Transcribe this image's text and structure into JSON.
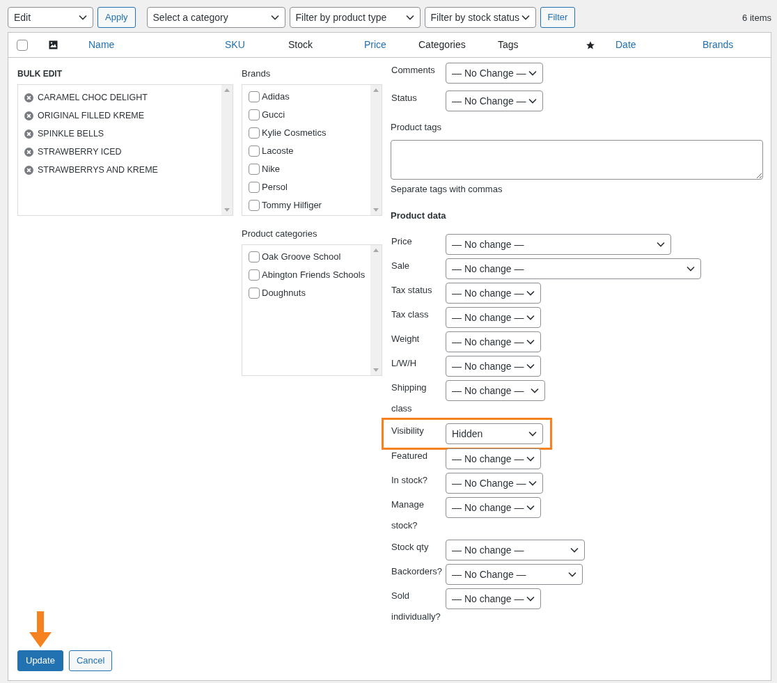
{
  "toolbar": {
    "bulk_action": "Edit",
    "apply": "Apply",
    "filters": [
      "Select a category",
      "Filter by product type",
      "Filter by stock status"
    ],
    "filter_button": "Filter",
    "count": "6 items"
  },
  "table": {
    "columns": [
      {
        "kind": "checkbox",
        "checked": false
      },
      {
        "kind": "image"
      },
      {
        "kind": "text",
        "label": "Name",
        "sortable": true
      },
      {
        "kind": "text",
        "label": "SKU",
        "sortable": true
      },
      {
        "kind": "text",
        "label": "Stock",
        "sortable": false
      },
      {
        "kind": "text",
        "label": "Price",
        "sortable": true
      },
      {
        "kind": "text",
        "label": "Categories",
        "sortable": false
      },
      {
        "kind": "text",
        "label": "Tags",
        "sortable": false
      },
      {
        "kind": "star"
      },
      {
        "kind": "text",
        "label": "Date",
        "sortable": true
      },
      {
        "kind": "text",
        "label": "Brands",
        "sortable": true
      }
    ]
  },
  "bulk_edit": {
    "title": "BULK EDIT",
    "products": [
      "CARAMEL CHOC DELIGHT",
      "ORIGINAL FILLED KREME",
      "SPINKLE BELLS",
      "STRAWBERRY ICED",
      "STRAWBERRYS AND KREME"
    ],
    "brands": {
      "label": "Brands",
      "items": [
        {
          "label": "Adidas",
          "checked": false
        },
        {
          "label": "Gucci",
          "checked": false
        },
        {
          "label": "Kylie Cosmetics",
          "checked": false
        },
        {
          "label": "Lacoste",
          "checked": false
        },
        {
          "label": "Nike",
          "checked": false
        },
        {
          "label": "Persol",
          "checked": false
        },
        {
          "label": "Tommy Hilfiger",
          "checked": false
        }
      ]
    },
    "categories": {
      "label": "Product categories",
      "items": [
        {
          "label": "Oak Groove School",
          "checked": false
        },
        {
          "label": "Abington Friends Schools",
          "checked": false
        },
        {
          "label": "Doughnuts",
          "checked": false
        }
      ]
    },
    "top_fields": [
      {
        "label": "Comments",
        "value": "— No Change —",
        "highlighted": false
      },
      {
        "label": "Status",
        "value": "— No Change —",
        "highlighted": false
      }
    ],
    "product_tags": {
      "label": "Product tags",
      "hint": "Separate tags with commas"
    },
    "product_data": {
      "heading": "Product data",
      "fields": [
        {
          "label": "Price",
          "value": "— No change —",
          "highlighted": false
        },
        {
          "label": "Sale",
          "value": "— No change —",
          "highlighted": false
        },
        {
          "label": "Tax status",
          "value": "— No change —",
          "highlighted": false
        },
        {
          "label": "Tax class",
          "value": "— No change —",
          "highlighted": false
        },
        {
          "label": "Weight",
          "value": "— No change —",
          "highlighted": false
        },
        {
          "label": "L/W/H",
          "value": "— No change —",
          "highlighted": false
        },
        {
          "label": "Shipping class",
          "value": "— No change —",
          "highlighted": false
        },
        {
          "label": "Visibility",
          "value": "Hidden",
          "highlighted": true
        },
        {
          "label": "Featured",
          "value": "— No change —",
          "highlighted": false
        },
        {
          "label": "In stock?",
          "value": "— No Change —",
          "highlighted": false
        },
        {
          "label": "Manage stock?",
          "value": "— No change —",
          "highlighted": false
        },
        {
          "label": "Stock qty",
          "value": "— No change —",
          "highlighted": false
        },
        {
          "label": "Backorders?",
          "value": "— No Change —",
          "highlighted": false
        },
        {
          "label": "Sold individually?",
          "value": "— No change —",
          "highlighted": false
        }
      ]
    },
    "buttons": [
      {
        "label": "Update",
        "kind": "primary",
        "pointed": true
      },
      {
        "label": "Cancel",
        "kind": "secondary",
        "pointed": false
      }
    ]
  }
}
